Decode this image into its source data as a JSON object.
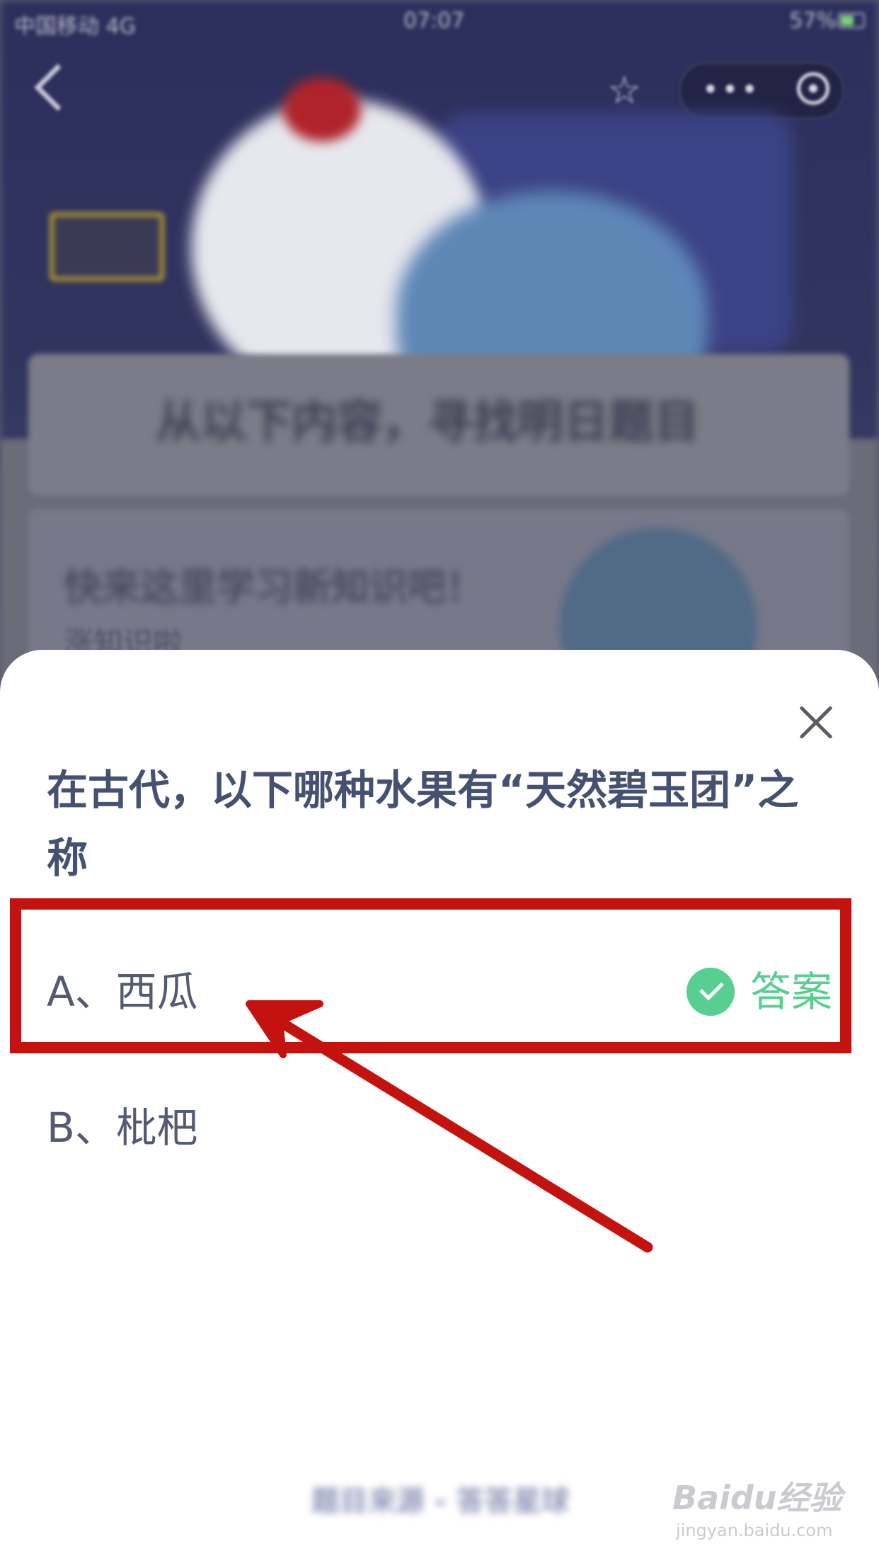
{
  "status_bar": {
    "carrier": "中国移动 4G",
    "time": "07:07",
    "battery": "57%"
  },
  "background": {
    "title": "从以下内容，寻找明日题目",
    "banner_title": "快来这里学习新知识吧！",
    "banner_subtitle": "涨知识啦"
  },
  "quiz": {
    "question": "在古代，以下哪种水果有“天然碧玉团”之称",
    "options": [
      {
        "label": "A、西瓜",
        "is_answer": true
      },
      {
        "label": "B、枇杷",
        "is_answer": false
      }
    ],
    "answer_label": "答案",
    "footer": "题目来源 - 答答星球"
  },
  "watermark": {
    "brand": "Baidu经验",
    "url": "jingyan.baidu.com"
  },
  "colors": {
    "question_text": "#455170",
    "answer_green": "#58cf91",
    "annotation_red": "#c4130f"
  },
  "icons": [
    "back-icon",
    "star-icon",
    "more-icon",
    "miniapp-close-icon",
    "close-icon",
    "check-icon"
  ]
}
